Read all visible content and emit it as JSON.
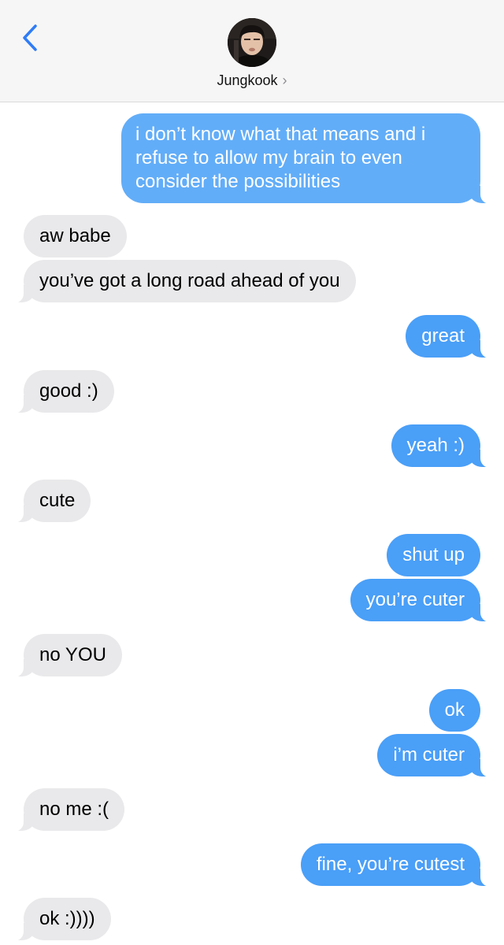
{
  "header": {
    "contact_name": "Jungkook",
    "chevron": "›",
    "back_icon": "chevron-left-icon",
    "accent_color": "#2f7cf6"
  },
  "messages": [
    {
      "from": "me",
      "lines": [
        "i don’t know what that means and i",
        "refuse to allow my brain to even",
        "consider the possibilities"
      ]
    },
    {
      "from": "them",
      "text": "aw babe"
    },
    {
      "from": "them",
      "text": "you’ve got a long road ahead of you"
    },
    {
      "from": "me",
      "text": "great"
    },
    {
      "from": "them",
      "text": "good :)"
    },
    {
      "from": "me",
      "text": "yeah :)"
    },
    {
      "from": "them",
      "text": "cute"
    },
    {
      "from": "me",
      "text": "shut up"
    },
    {
      "from": "me",
      "text": "you’re cuter"
    },
    {
      "from": "them",
      "text": "no YOU"
    },
    {
      "from": "me",
      "text": "ok"
    },
    {
      "from": "me",
      "text": "i’m cuter"
    },
    {
      "from": "them",
      "text": "no me :("
    },
    {
      "from": "me",
      "text": "fine, you’re cutest"
    },
    {
      "from": "them",
      "text": "ok :))))"
    }
  ],
  "colors": {
    "sent_bubble": "#4a9ff7",
    "received_bubble": "#e9e9eb",
    "header_bg": "#f6f6f6"
  }
}
